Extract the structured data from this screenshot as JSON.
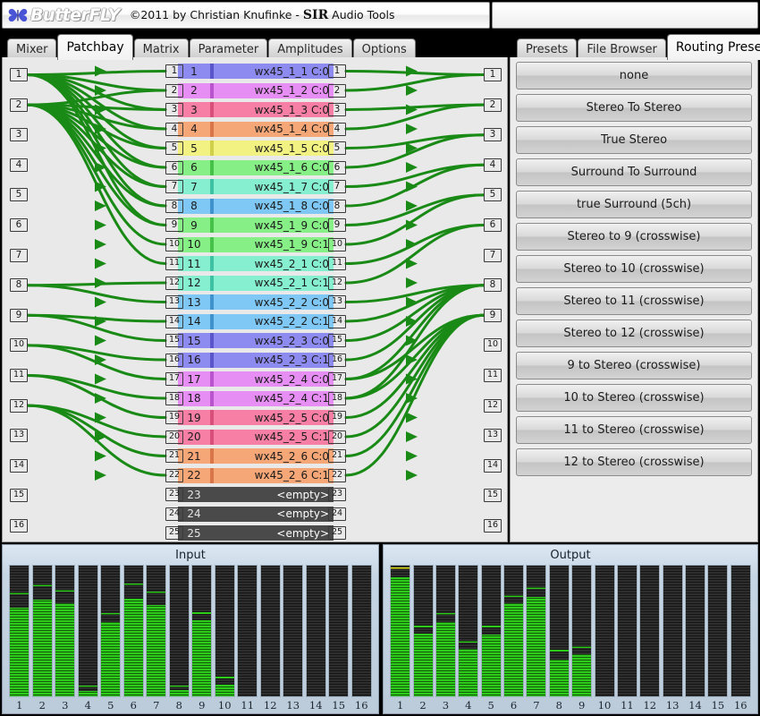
{
  "header": {
    "logo_icon": "butterfly-icon",
    "logo_text": "ButterFLY",
    "copyright_pre": "©2011 by Christian Knufinke  -  ",
    "copyright_brand": "SIR",
    "copyright_post": " Audio Tools"
  },
  "main_tabs": [
    {
      "label": "Mixer",
      "active": false
    },
    {
      "label": "Patchbay",
      "active": true
    },
    {
      "label": "Matrix",
      "active": false
    },
    {
      "label": "Parameter",
      "active": false
    },
    {
      "label": "Amplitudes",
      "active": false
    },
    {
      "label": "Options",
      "active": false
    }
  ],
  "right_tabs": [
    {
      "label": "Presets",
      "active": false
    },
    {
      "label": "File Browser",
      "active": false
    },
    {
      "label": "Routing Presets",
      "active": true
    }
  ],
  "routing_presets": [
    "none",
    "Stereo To Stereo",
    "True Stereo",
    "Surround To Surround",
    "true Surround (5ch)",
    "Stereo to 9 (crosswise)",
    "Stereo to 10 (crosswise)",
    "Stereo to 11 (crosswise)",
    "Stereo to 12 (crosswise)",
    "9 to Stereo (crosswise)",
    "10 to Stereo (crosswise)",
    "11 to Stereo (crosswise)",
    "12 to Stereo (crosswise)"
  ],
  "input_ports": [
    "1",
    "2",
    "3",
    "4",
    "5",
    "6",
    "7",
    "8",
    "9",
    "10",
    "11",
    "12",
    "13",
    "14",
    "15",
    "16"
  ],
  "output_ports": [
    "1",
    "2",
    "3",
    "4",
    "5",
    "6",
    "7",
    "8",
    "9",
    "10",
    "11",
    "12",
    "13",
    "14",
    "15",
    "16"
  ],
  "patch_rows": [
    {
      "num": "1",
      "label": "wx45_1_1 C:0",
      "color": "#8e8bf0",
      "bar": "#5a55c8",
      "empty": false
    },
    {
      "num": "2",
      "label": "wx45_1_2 C:0",
      "color": "#e78ef5",
      "bar": "#b855cc",
      "empty": false
    },
    {
      "num": "3",
      "label": "wx45_1_3 C:0",
      "color": "#f77fa6",
      "bar": "#d6507a",
      "empty": false
    },
    {
      "num": "4",
      "label": "wx45_1_4 C:0",
      "color": "#f6a777",
      "bar": "#d8764a",
      "empty": false
    },
    {
      "num": "5",
      "label": "wx45_1_5 C:0",
      "color": "#f2f283",
      "bar": "#cfcf4a",
      "empty": false
    },
    {
      "num": "6",
      "label": "wx45_1_6 C:0",
      "color": "#86ef86",
      "bar": "#46c24a",
      "empty": false
    },
    {
      "num": "7",
      "label": "wx45_1_7 C:0",
      "color": "#86efd0",
      "bar": "#3fc2a4",
      "empty": false
    },
    {
      "num": "8",
      "label": "wx45_1_8 C:0",
      "color": "#7fc7f4",
      "bar": "#3f92cc",
      "empty": false
    },
    {
      "num": "9",
      "label": "wx45_1_9 C:0",
      "color": "#86ef86",
      "bar": "#46c24a",
      "empty": false
    },
    {
      "num": "10",
      "label": "wx45_1_9 C:1",
      "color": "#86ef86",
      "bar": "#46c24a",
      "empty": false
    },
    {
      "num": "11",
      "label": "wx45_2_1 C:0",
      "color": "#86efd0",
      "bar": "#3fc2a4",
      "empty": false
    },
    {
      "num": "12",
      "label": "wx45_2_1 C:1",
      "color": "#86efd0",
      "bar": "#3fc2a4",
      "empty": false
    },
    {
      "num": "13",
      "label": "wx45_2_2 C:0",
      "color": "#7fc7f4",
      "bar": "#3f92cc",
      "empty": false
    },
    {
      "num": "14",
      "label": "wx45_2_2 C:1",
      "color": "#7fc7f4",
      "bar": "#3f92cc",
      "empty": false
    },
    {
      "num": "15",
      "label": "wx45_2_3 C:0",
      "color": "#8e8bf0",
      "bar": "#5a55c8",
      "empty": false
    },
    {
      "num": "16",
      "label": "wx45_2_3 C:1",
      "color": "#8e8bf0",
      "bar": "#5a55c8",
      "empty": false
    },
    {
      "num": "17",
      "label": "wx45_2_4 C:0",
      "color": "#e78ef5",
      "bar": "#b855cc",
      "empty": false
    },
    {
      "num": "18",
      "label": "wx45_2_4 C:1",
      "color": "#e78ef5",
      "bar": "#b855cc",
      "empty": false
    },
    {
      "num": "19",
      "label": "wx45_2_5 C:0",
      "color": "#f77fa6",
      "bar": "#d6507a",
      "empty": false
    },
    {
      "num": "20",
      "label": "wx45_2_5 C:1",
      "color": "#f77fa6",
      "bar": "#d6507a",
      "empty": false
    },
    {
      "num": "21",
      "label": "wx45_2_6 C:0",
      "color": "#f6a777",
      "bar": "#d8764a",
      "empty": false
    },
    {
      "num": "22",
      "label": "wx45_2_6 C:1",
      "color": "#f6a777",
      "bar": "#d8764a",
      "empty": false
    },
    {
      "num": "23",
      "label": "<empty>",
      "color": "#4a4a4a",
      "bar": "#4a4a4a",
      "empty": true
    },
    {
      "num": "24",
      "label": "<empty>",
      "color": "#4a4a4a",
      "bar": "#4a4a4a",
      "empty": true
    },
    {
      "num": "25",
      "label": "<empty>",
      "color": "#4a4a4a",
      "bar": "#4a4a4a",
      "empty": true
    }
  ],
  "connections": {
    "line_color": "#1a8a16",
    "left": [
      {
        "from": 1,
        "to": 1
      },
      {
        "from": 1,
        "to": 2
      },
      {
        "from": 1,
        "to": 3
      },
      {
        "from": 1,
        "to": 4
      },
      {
        "from": 1,
        "to": 5
      },
      {
        "from": 1,
        "to": 6
      },
      {
        "from": 1,
        "to": 7
      },
      {
        "from": 1,
        "to": 8
      },
      {
        "from": 1,
        "to": 9
      },
      {
        "from": 2,
        "to": 2
      },
      {
        "from": 2,
        "to": 3
      },
      {
        "from": 2,
        "to": 4
      },
      {
        "from": 2,
        "to": 5
      },
      {
        "from": 2,
        "to": 6
      },
      {
        "from": 2,
        "to": 7
      },
      {
        "from": 2,
        "to": 8
      },
      {
        "from": 2,
        "to": 9
      },
      {
        "from": 2,
        "to": 10
      },
      {
        "from": 2,
        "to": 11
      },
      {
        "from": 8,
        "to": 12
      },
      {
        "from": 8,
        "to": 13
      },
      {
        "from": 9,
        "to": 14
      },
      {
        "from": 9,
        "to": 15
      },
      {
        "from": 10,
        "to": 16
      },
      {
        "from": 10,
        "to": 17
      },
      {
        "from": 11,
        "to": 18
      },
      {
        "from": 11,
        "to": 19
      },
      {
        "from": 12,
        "to": 20
      },
      {
        "from": 12,
        "to": 21
      },
      {
        "from": 12,
        "to": 22
      }
    ],
    "right": [
      {
        "from": 1,
        "to": 1
      },
      {
        "from": 2,
        "to": 1
      },
      {
        "from": 3,
        "to": 2
      },
      {
        "from": 4,
        "to": 2
      },
      {
        "from": 5,
        "to": 3
      },
      {
        "from": 6,
        "to": 3
      },
      {
        "from": 7,
        "to": 4
      },
      {
        "from": 8,
        "to": 4
      },
      {
        "from": 9,
        "to": 5
      },
      {
        "from": 10,
        "to": 5
      },
      {
        "from": 11,
        "to": 6
      },
      {
        "from": 12,
        "to": 6
      },
      {
        "from": 13,
        "to": 8
      },
      {
        "from": 14,
        "to": 8
      },
      {
        "from": 15,
        "to": 8
      },
      {
        "from": 16,
        "to": 8
      },
      {
        "from": 17,
        "to": 8
      },
      {
        "from": 18,
        "to": 8
      },
      {
        "from": 17,
        "to": 9
      },
      {
        "from": 18,
        "to": 9
      },
      {
        "from": 19,
        "to": 9
      },
      {
        "from": 20,
        "to": 9
      },
      {
        "from": 21,
        "to": 9
      },
      {
        "from": 22,
        "to": 9
      }
    ]
  },
  "meters": {
    "input": {
      "title": "Input",
      "labels": [
        "1",
        "2",
        "3",
        "4",
        "5",
        "6",
        "7",
        "8",
        "9",
        "10",
        "11",
        "12",
        "13",
        "14",
        "15",
        "16"
      ],
      "levels": [
        68,
        74,
        71,
        4,
        57,
        75,
        70,
        5,
        58,
        9,
        0,
        0,
        0,
        0,
        0,
        0
      ],
      "peaks": [
        78,
        84,
        80,
        7,
        62,
        85,
        79,
        7,
        63,
        14,
        0,
        0,
        0,
        0,
        0,
        0
      ],
      "peak_colors": [
        "#2ecc1a",
        "#2ecc1a",
        "#2ecc1a",
        "#2ecc1a",
        "#2ecc1a",
        "#2ecc1a",
        "#2ecc1a",
        "#2ecc1a",
        "#2ecc1a",
        "#2ecc1a",
        "#2ecc1a",
        "#2ecc1a",
        "#2ecc1a",
        "#2ecc1a",
        "#2ecc1a",
        "#2ecc1a"
      ]
    },
    "output": {
      "title": "Output",
      "labels": [
        "1",
        "2",
        "3",
        "4",
        "5",
        "6",
        "7",
        "8",
        "9",
        "10",
        "11",
        "12",
        "13",
        "14",
        "15",
        "16"
      ],
      "levels": [
        91,
        48,
        57,
        36,
        47,
        71,
        76,
        28,
        32,
        0,
        0,
        0,
        0,
        0,
        0,
        0
      ],
      "peaks": [
        97,
        53,
        62,
        41,
        53,
        76,
        82,
        34,
        37,
        0,
        0,
        0,
        0,
        0,
        0,
        0
      ],
      "peak_colors": [
        "#e8e81c",
        "#2ecc1a",
        "#2ecc1a",
        "#2ecc1a",
        "#2ecc1a",
        "#2ecc1a",
        "#2ecc1a",
        "#2ecc1a",
        "#2ecc1a",
        "#2ecc1a",
        "#2ecc1a",
        "#2ecc1a",
        "#2ecc1a",
        "#2ecc1a",
        "#2ecc1a",
        "#2ecc1a"
      ]
    }
  }
}
